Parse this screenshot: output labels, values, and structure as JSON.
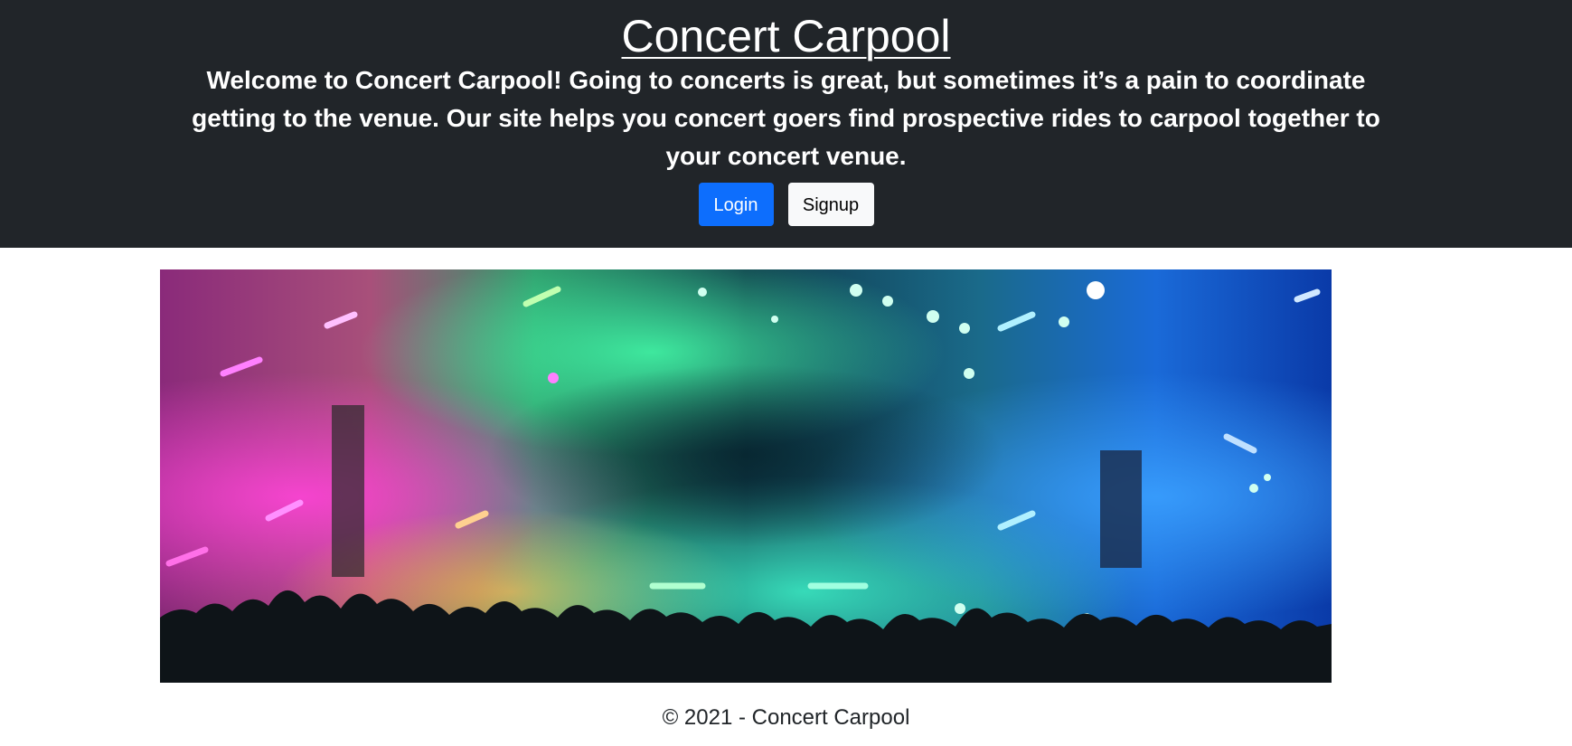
{
  "header": {
    "title": "Concert Carpool",
    "tagline": "Welcome to Concert Carpool! Going to concerts is great, but sometimes it’s a pain to coordinate getting to the venue. Our site helps you concert goers find prospective rides to carpool together to your concert venue.",
    "login_label": "Login",
    "signup_label": "Signup"
  },
  "hero": {
    "image_alt": "Concert crowd with colorful stage lights"
  },
  "footer": {
    "copyright": "© 2021 - Concert Carpool"
  },
  "colors": {
    "header_bg": "#212529",
    "primary": "#0d6efd",
    "light": "#f8f9fa"
  }
}
